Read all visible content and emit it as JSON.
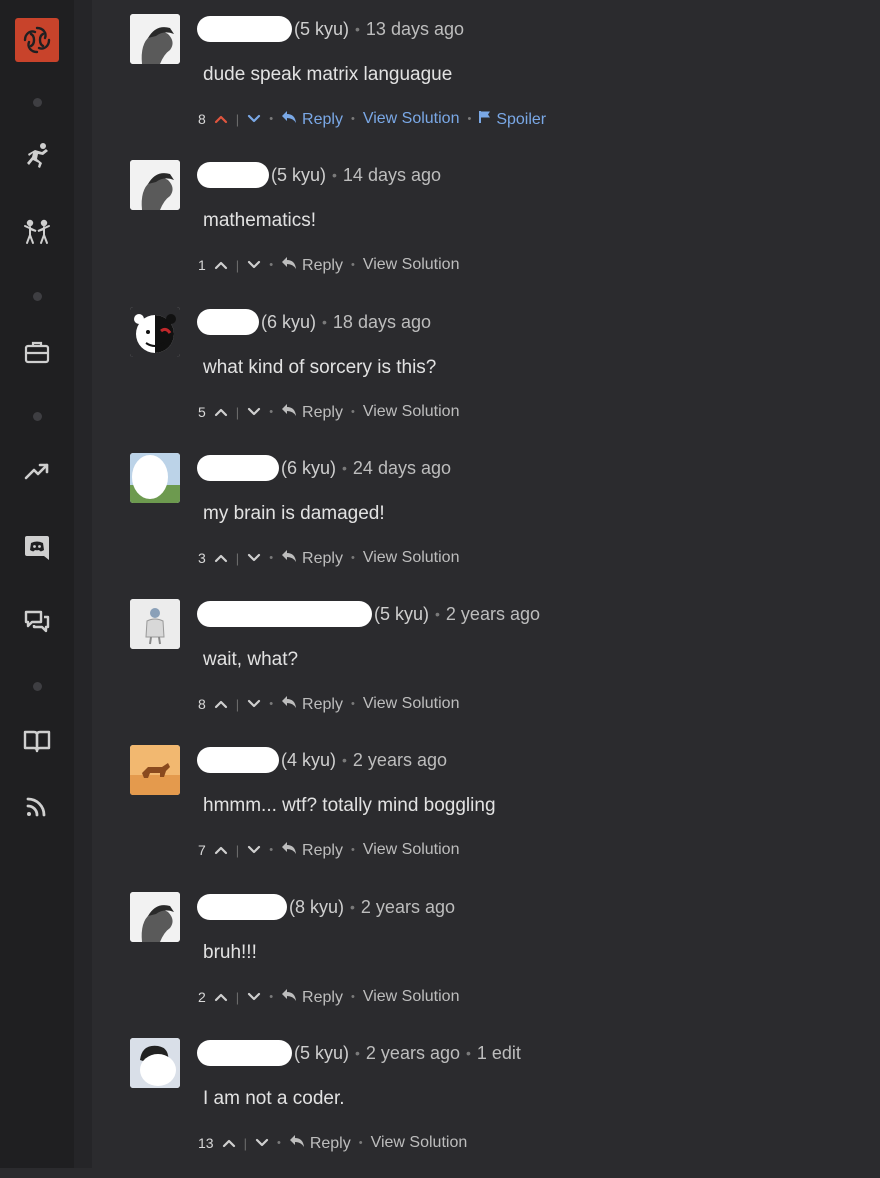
{
  "sidebar": {
    "logo_icon": "codewars-logo-icon",
    "items": [
      {
        "name": "training-icon"
      },
      {
        "name": "kumite-icon"
      },
      {
        "name": "briefcase-icon"
      },
      {
        "name": "trending-icon"
      },
      {
        "name": "discord-icon"
      },
      {
        "name": "discussions-icon"
      },
      {
        "name": "docs-book-icon"
      },
      {
        "name": "rss-feed-icon"
      }
    ]
  },
  "comments": [
    {
      "rank": "(5 kyu)",
      "time": "13 days ago",
      "edit": "",
      "text": "dude speak matrix languague",
      "votes": "8",
      "upvoted": true,
      "reply": "Reply",
      "view_solution": "View Solution",
      "spoiler": "Spoiler",
      "links_blue": true
    },
    {
      "rank": "(5 kyu)",
      "time": "14 days ago",
      "edit": "",
      "text": "mathematics!",
      "votes": "1",
      "upvoted": false,
      "reply": "Reply",
      "view_solution": "View Solution",
      "spoiler": "",
      "links_blue": false
    },
    {
      "rank": "(6 kyu)",
      "time": "18 days ago",
      "edit": "",
      "text": "what kind of sorcery is this?",
      "votes": "5",
      "upvoted": false,
      "reply": "Reply",
      "view_solution": "View Solution",
      "spoiler": "",
      "links_blue": false
    },
    {
      "rank": "(6 kyu)",
      "time": "24 days ago",
      "edit": "",
      "text": "my brain is damaged!",
      "votes": "3",
      "upvoted": false,
      "reply": "Reply",
      "view_solution": "View Solution",
      "spoiler": "",
      "links_blue": false
    },
    {
      "rank": "(5 kyu)",
      "time": "2 years ago",
      "edit": "",
      "text": "wait, what?",
      "votes": "8",
      "upvoted": false,
      "reply": "Reply",
      "view_solution": "View Solution",
      "spoiler": "",
      "links_blue": false
    },
    {
      "rank": "(4 kyu)",
      "time": "2 years ago",
      "edit": "",
      "text": "hmmm... wtf? totally mind boggling",
      "votes": "7",
      "upvoted": false,
      "reply": "Reply",
      "view_solution": "View Solution",
      "spoiler": "",
      "links_blue": false
    },
    {
      "rank": "(8 kyu)",
      "time": "2 years ago",
      "edit": "",
      "text": "bruh!!!",
      "votes": "2",
      "upvoted": false,
      "reply": "Reply",
      "view_solution": "View Solution",
      "spoiler": "",
      "links_blue": false
    },
    {
      "rank": "(5 kyu)",
      "time": "2 years ago",
      "edit": "1 edit",
      "text": "I am not a coder.",
      "votes": "13",
      "upvoted": false,
      "reply": "Reply",
      "view_solution": "View Solution",
      "spoiler": "",
      "links_blue": false
    }
  ],
  "colors": {
    "background": "#2b2b2e",
    "sidebar": "#1f1f21",
    "logo": "#c8432b",
    "link_blue": "#7aa8e6",
    "upvote_active": "#e0553e"
  }
}
